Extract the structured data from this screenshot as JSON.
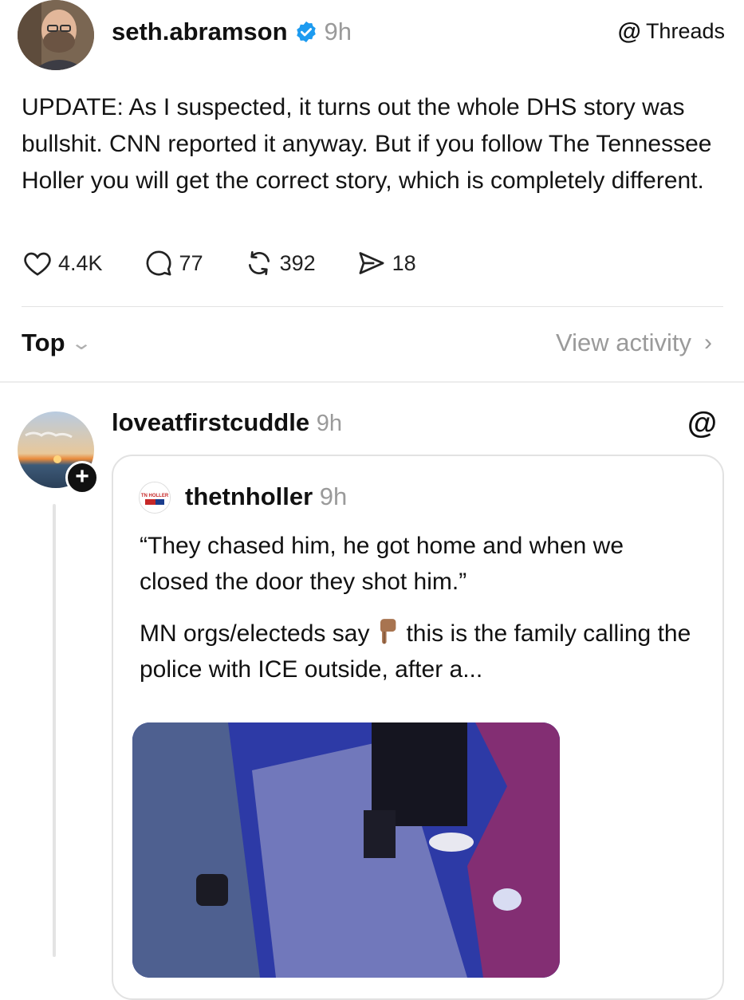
{
  "post": {
    "author": "seth.abramson",
    "time": "9h",
    "source_label": "Threads",
    "text": "UPDATE: As I suspected, it turns out the whole DHS story was bullshit. CNN reported it anyway. But if you follow The Tennessee Holler you will get the correct story, which is completely different.",
    "likes": "4.4K",
    "comments": "77",
    "reposts": "392",
    "shares": "18"
  },
  "sort": {
    "label": "Top",
    "view_activity": "View activity"
  },
  "reply": {
    "author": "loveatfirstcuddle",
    "time": "9h",
    "quote": {
      "author": "thetnholler",
      "time": "9h",
      "logo_text": "TN HOLLER",
      "text1": "“They chased him, he got home and when we closed the door they shot him.”",
      "text2_before": "MN orgs/electeds say",
      "text2_after": "this is the family calling the police with ICE outside, after a..."
    }
  },
  "colors": {
    "verified": "#1d9bf0",
    "muted": "#9a9a9a",
    "divider": "#e3e3e3"
  },
  "icons": [
    "verified-badge-icon",
    "threads-logo-icon",
    "heart-icon",
    "comment-icon",
    "repost-icon",
    "share-icon",
    "chevron-down-icon",
    "chevron-right-icon",
    "plus-icon",
    "pointing-down-emoji"
  ]
}
